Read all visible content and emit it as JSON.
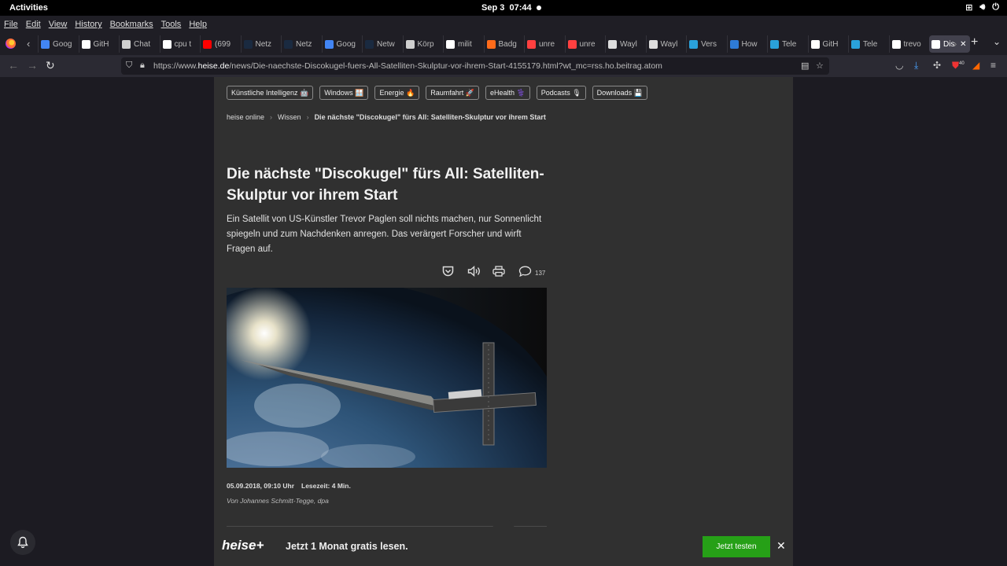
{
  "system": {
    "activities": "Activities",
    "date": "Sep 3",
    "time": "07:44"
  },
  "menu": [
    "File",
    "Edit",
    "View",
    "History",
    "Bookmarks",
    "Tools",
    "Help"
  ],
  "tabs": [
    {
      "label": "Goog",
      "color": "#4285f4"
    },
    {
      "label": "GitH",
      "color": "#ffffff"
    },
    {
      "label": "Chat",
      "color": "#cfcfcf"
    },
    {
      "label": "cpu t",
      "color": "#ffffff"
    },
    {
      "label": "(699",
      "color": "#ff0000"
    },
    {
      "label": "Netz",
      "color": "#1a2a40"
    },
    {
      "label": "Netz",
      "color": "#1a2a40"
    },
    {
      "label": "Goog",
      "color": "#4285f4"
    },
    {
      "label": "Netw",
      "color": "#1a2a40"
    },
    {
      "label": "Körp",
      "color": "#cfcfcf"
    },
    {
      "label": "milit",
      "color": "#ffffff"
    },
    {
      "label": "Badg",
      "color": "#ff6b1a"
    },
    {
      "label": "unre",
      "color": "#ff4040"
    },
    {
      "label": "unre",
      "color": "#ff4040"
    },
    {
      "label": "Wayl",
      "color": "#dddddd"
    },
    {
      "label": "Wayl",
      "color": "#dddddd"
    },
    {
      "label": "Vers",
      "color": "#2aa1da"
    },
    {
      "label": "How",
      "color": "#2e7bd6"
    },
    {
      "label": "Tele",
      "color": "#2aa1da"
    },
    {
      "label": "GitH",
      "color": "#ffffff"
    },
    {
      "label": "Tele",
      "color": "#2aa1da"
    },
    {
      "label": "trevo",
      "color": "#ffffff"
    },
    {
      "label": "Dis",
      "color": "#ffffff",
      "active": true
    }
  ],
  "url": {
    "prefix": "https://www.",
    "domain": "heise.de",
    "path": "/news/Die-naechste-Discokugel-fuers-All-Satelliten-Skulptur-vor-ihrem-Start-4155179.html?wt_mc=rss.ho.beitrag.atom"
  },
  "toolbar": {
    "downloads_badge": "40"
  },
  "topics": [
    "Künstliche Intelligenz 🤖",
    "Windows 🪟",
    "Energie 🔥",
    "Raumfahrt 🚀",
    "eHealth ⚕️",
    "Podcasts 🎙",
    "Downloads 💾"
  ],
  "breadcrumb": {
    "home": "heise online",
    "section": "Wissen",
    "current": "Die nächste \"Discokugel\" fürs All: Satelliten-Skulptur vor ihrem Start"
  },
  "article": {
    "title": "Die nächste \"Discokugel\" fürs All: Satelliten-Skulptur vor ihrem Start",
    "lead": "Ein Satellit von US-Künstler Trevor Paglen soll nichts machen, nur Sonnenlicht spiegeln und zum Nachdenken anregen. Das verärgert Forscher und wirft Fragen auf.",
    "comment_count": "137",
    "date": "05.09.2018, 09:10 Uhr",
    "reading_time": "Lesezeit: 4 Min.",
    "author": "Von Johannes Schmitt-Tegge, dpa"
  },
  "promo": {
    "logo": "heise+",
    "text": "Jetzt 1 Monat gratis lesen.",
    "button": "Jetzt testen",
    "close": "✕"
  },
  "icons": {
    "pocket": "pocket-icon",
    "speaker": "read-aloud-icon",
    "print": "print-icon",
    "comment": "comment-icon",
    "bell": "bell-icon"
  }
}
